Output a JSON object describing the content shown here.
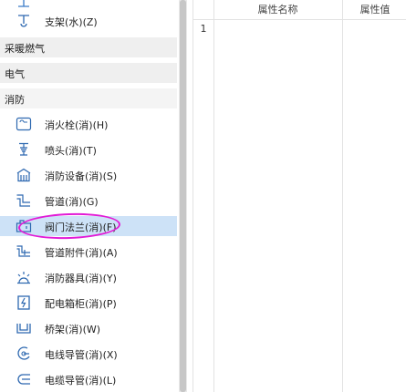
{
  "tree": {
    "top_items": [
      {
        "label": "支架(水)(Z)",
        "icon": "pipe-support-icon"
      }
    ],
    "categories": [
      {
        "label": "采暖燃气"
      },
      {
        "label": "电气"
      },
      {
        "label": "消防"
      }
    ],
    "fire_items": [
      {
        "label": "消火栓(消)(H)",
        "icon": "fire-hydrant-icon"
      },
      {
        "label": "喷头(消)(T)",
        "icon": "sprinkler-icon"
      },
      {
        "label": "消防设备(消)(S)",
        "icon": "fire-equipment-icon"
      },
      {
        "label": "管道(消)(G)",
        "icon": "pipe-icon"
      },
      {
        "label": "阀门法兰(消)(F)",
        "icon": "valve-flange-icon"
      },
      {
        "label": "管道附件(消)(A)",
        "icon": "pipe-fitting-icon"
      },
      {
        "label": "消防器具(消)(Y)",
        "icon": "fire-appliance-icon"
      },
      {
        "label": "配电箱柜(消)(P)",
        "icon": "distribution-box-icon"
      },
      {
        "label": "桥架(消)(W)",
        "icon": "cable-tray-icon"
      },
      {
        "label": "电线导管(消)(X)",
        "icon": "wire-conduit-icon"
      },
      {
        "label": "电缆导管(消)(L)",
        "icon": "cable-conduit-icon"
      }
    ],
    "selected_index": 4
  },
  "properties": {
    "columns": [
      "属性名称",
      "属性值"
    ],
    "rows": [
      {
        "num": "1",
        "name": "",
        "value": ""
      }
    ]
  },
  "colors": {
    "selection": "#cde2f7",
    "highlight_ring": "#e21bd6",
    "category_bg": "#efefef"
  }
}
